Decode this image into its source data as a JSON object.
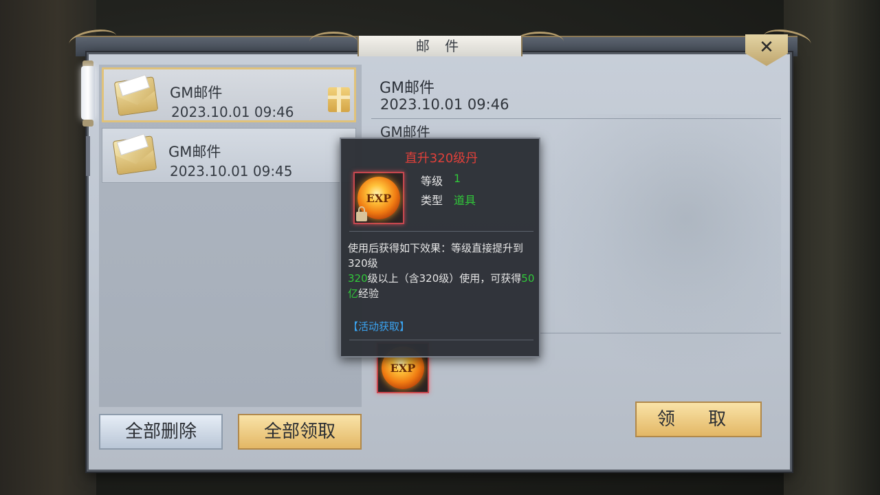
{
  "window": {
    "title": "邮 件",
    "close_label": "✕"
  },
  "mail_list": [
    {
      "title": "GM邮件",
      "time": "2023.10.01   09:46"
    },
    {
      "title": "GM邮件",
      "time": "2023.10.01   09:45"
    }
  ],
  "buttons": {
    "delete_all": "全部删除",
    "claim_all": "全部领取",
    "claim": "领 取"
  },
  "detail": {
    "sender": "GM邮件",
    "time": "2023.10.01   09:46",
    "from": "GM邮件",
    "attachment_icon_text": "EXP"
  },
  "tooltip": {
    "item_name": "直升320级丹",
    "level_label": "等级",
    "level_value": "1",
    "type_label": "类型",
    "type_value": "道具",
    "icon_text": "EXP",
    "desc_line1": "使用后获得如下效果：等级直接提升到320级",
    "desc2_green1": "320",
    "desc2_text1": "级以上（含320级）使用，可获得",
    "desc2_green2": "50亿",
    "desc2_text2": "经验",
    "source_link": "【活动获取】"
  },
  "colors": {
    "accent_gold": "#e3b765",
    "item_name_red": "#e0403a",
    "value_green": "#31c93a",
    "link_blue": "#3aa3f0"
  }
}
